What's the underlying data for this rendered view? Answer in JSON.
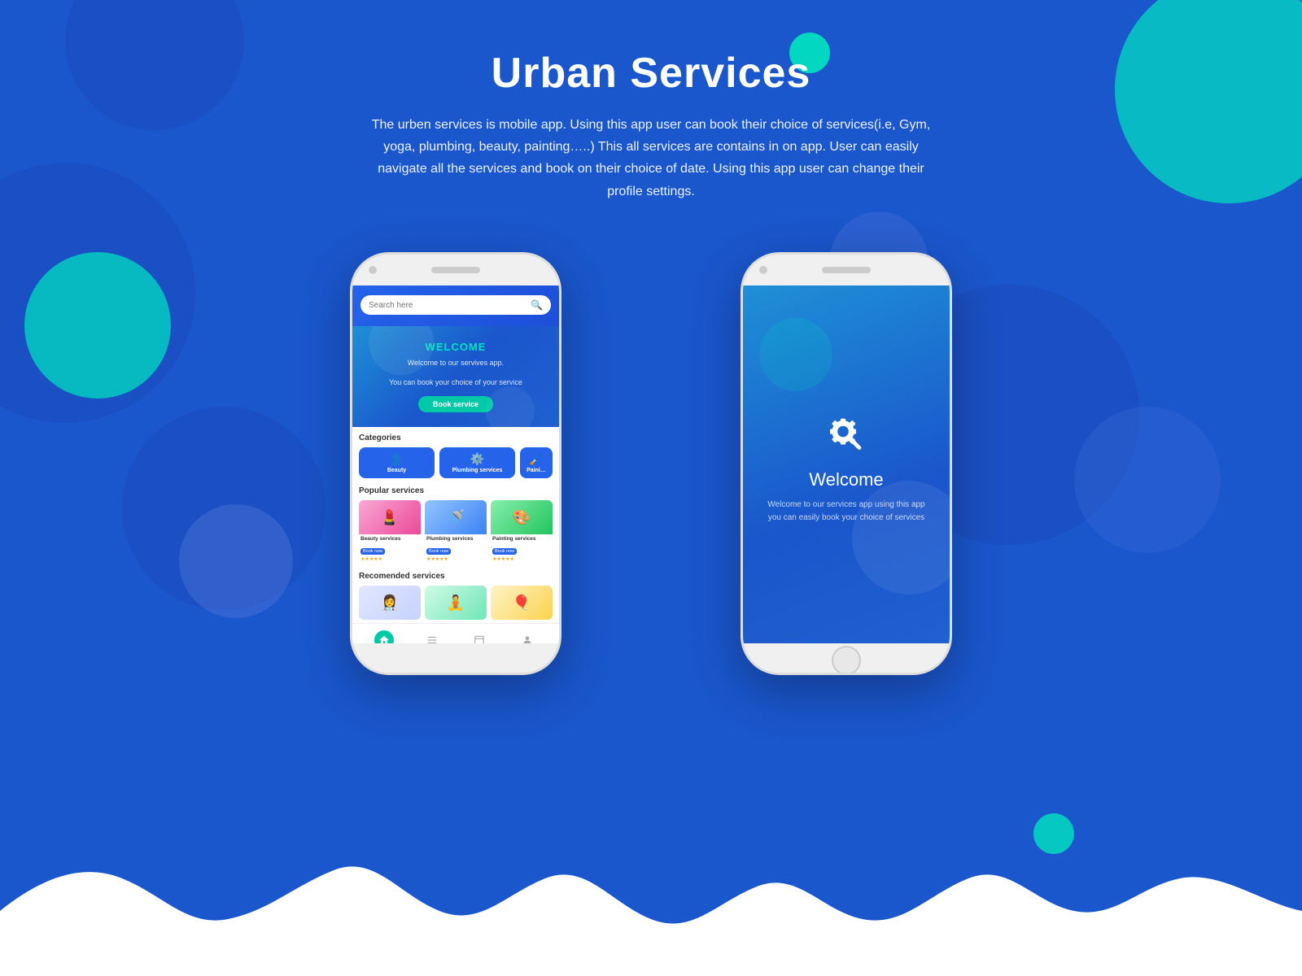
{
  "page": {
    "background_color": "#1a56cc",
    "title": "Urban Services",
    "subtitle": "The urben services is mobile app. Using this app user can book their choice of services(i.e, Gym, yoga, plumbing, beauty, painting…..)\nThis all services are contains in on app. User can easily navigate all the services and book on their choice of date.\nUsing this app user can change their profile settings."
  },
  "left_phone": {
    "search_placeholder": "Search here",
    "welcome": {
      "heading": "WELCOME",
      "line1": "Welcome to our servives app.",
      "line2": "You can book your choice of your service",
      "button": "Book service"
    },
    "categories": {
      "label": "Categories",
      "items": [
        {
          "icon": "👤",
          "label": "Beauty"
        },
        {
          "icon": "🔧",
          "label": "Plumbing services"
        },
        {
          "icon": "🖌️",
          "label": "Paini..."
        }
      ]
    },
    "popular_services": {
      "label": "Popular services",
      "items": [
        {
          "name": "Beauty services",
          "emoji": "💄",
          "stars": "★★★★★",
          "book": "Book now"
        },
        {
          "name": "Plumbing services",
          "emoji": "🚿",
          "stars": "★★★★★",
          "book": "Book now"
        },
        {
          "name": "Painting services",
          "emoji": "🎨",
          "stars": "★★★★★",
          "book": "Book now"
        }
      ]
    },
    "recommended_services": {
      "label": "Recomended services",
      "items": [
        {
          "emoji": "👩‍⚕️",
          "color": "doctor"
        },
        {
          "emoji": "🧘",
          "color": "fitness"
        },
        {
          "emoji": "🎈",
          "color": "decor"
        }
      ]
    },
    "nav": [
      {
        "icon": "home",
        "active": true
      },
      {
        "icon": "list",
        "active": false
      },
      {
        "icon": "calendar",
        "active": false
      },
      {
        "icon": "person",
        "active": false
      }
    ]
  },
  "right_phone": {
    "splash": {
      "welcome": "Welcome",
      "subtitle": "Welcome to our services app\nusing this app you can easily book your choice\nof services"
    }
  }
}
